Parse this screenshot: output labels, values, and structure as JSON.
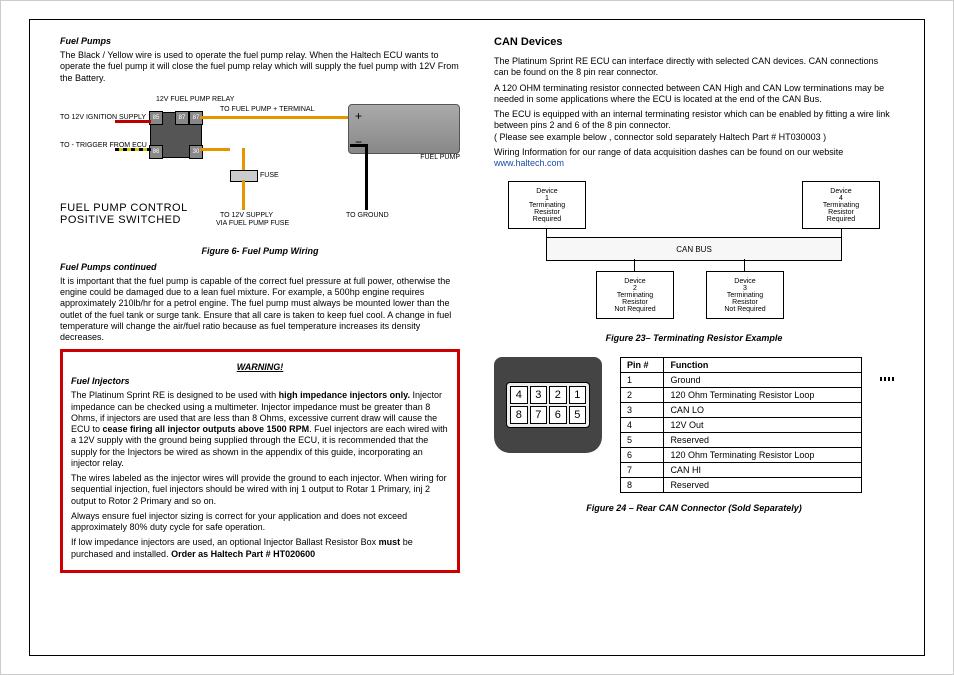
{
  "left": {
    "fuel_pumps_heading": "Fuel Pumps",
    "fuel_pumps_p1": "The Black / Yellow wire is used to operate the fuel pump relay. When the Haltech ECU wants to operate the fuel pump it will close the fuel pump relay which will supply the fuel pump with 12V From the Battery.",
    "diagram_labels": {
      "relay_title": "12V FUEL PUMP RELAY",
      "pin85": "85",
      "pin87": "87",
      "pin87b": "87",
      "pin86": "86",
      "pin30": "30",
      "to_ignition": "TO 12V IGNITION SUPPLY",
      "to_trigger": "TO - TRIGGER FROM ECU",
      "to_terminal": "TO FUEL PUMP + TERMINAL",
      "fuel_pump": "FUEL PUMP",
      "fuse": "FUSE",
      "to_12v_supply": "TO 12V SUPPLY",
      "via_fuse": "VIA FUEL PUMP FUSE",
      "to_ground": "TO GROUND",
      "control_title_1": "FUEL PUMP CONTROL",
      "control_title_2": "POSITIVE SWITCHED"
    },
    "figure6_caption": "Figure 6- Fuel Pump Wiring",
    "fuel_pumps_cont_heading": "Fuel Pumps continued",
    "fuel_pumps_p2": "It is important that the fuel pump is capable of the correct fuel pressure at full power, otherwise the engine could be damaged due to a lean fuel mixture. For example, a 500hp engine requires approximately 210lb/hr for a petrol engine. The fuel pump must always be mounted lower than the outlet of the fuel tank or surge tank. Ensure that all care is taken to keep fuel cool. A change in fuel temperature will change the air/fuel ratio because as fuel temperature increases its density decreases.",
    "warning_title": "WARNING!",
    "injectors_heading": "Fuel Injectors",
    "inj_p1_a": "The Platinum Sprint RE is designed to be used with ",
    "inj_p1_b": "high impedance injectors only.",
    "inj_p1_c": " Injector impedance can be checked using a multimeter. Injector impedance must be greater than 8 Ohms, if injectors are used that are less than 8 Ohms, excessive current draw will cause the ECU to ",
    "inj_p1_d": "cease firing all injector outputs above 1500 RPM",
    "inj_p1_e": ". Fuel injectors are each wired with a 12V supply with the ground being supplied through the ECU, it is recommended that the supply for the Injectors be wired as shown in the appendix of this guide, incorporating an injector relay.",
    "inj_p2": "The wires labeled as the injector wires will provide the ground to each injector. When wiring for sequential injection, fuel injectors should be wired with inj 1 output to Rotar 1 Primary, inj 2 output to Rotor 2 Primary and so on.",
    "inj_p3": "Always ensure fuel injector sizing is correct for your application and does not exceed approximately 80% duty cycle for safe operation.",
    "inj_p4_a": "If low impedance injectors are used, an optional Injector Ballast Resistor Box ",
    "inj_p4_b": "must",
    "inj_p4_c": " be purchased and installed.  ",
    "inj_p4_d": "Order as Haltech Part # HT020600"
  },
  "right": {
    "can_heading": "CAN Devices",
    "can_p1": "The Platinum Sprint RE ECU can interface directly with selected CAN devices. CAN connections can be found on the 8 pin rear connector.",
    "can_p2": "A 120 OHM terminating resistor connected between CAN High and CAN Low terminations may be needed in some applications where the ECU is located at the end of the CAN Bus.",
    "can_p3": "The ECU is equipped with an internal terminating resistor which can be enabled by fitting a wire link between pins 2 and 6 of the 8 pin connector.",
    "can_p3b": "( Please see example below , connector sold separately Haltech Part # HT030003 )",
    "can_p4": "Wiring Information for our range of data acquisition dashes can be found on our website ",
    "website": "www.haltech.com",
    "canbus_label": "CAN BUS",
    "devices": {
      "d1": "Device\n1\nTerminating\nResistor\nRequired",
      "d2": "Device\n2\nTerminating\nResistor\nNot Required",
      "d3": "Device\n3\nTerminating\nResistor\nNot Required",
      "d4": "Device\n4\nTerminating\nResistor\nRequired"
    },
    "figure23_caption": "Figure  23– Terminating Resistor Example",
    "pin_header_num": "Pin #",
    "pin_header_func": "Function",
    "pins": [
      {
        "n": "1",
        "f": "Ground"
      },
      {
        "n": "2",
        "f": "120 Ohm Terminating Resistor Loop"
      },
      {
        "n": "3",
        "f": "CAN LO"
      },
      {
        "n": "4",
        "f": "12V Out"
      },
      {
        "n": "5",
        "f": "Reserved"
      },
      {
        "n": "6",
        "f": "120 Ohm Terminating Resistor Loop"
      },
      {
        "n": "7",
        "f": "CAN HI"
      },
      {
        "n": "8",
        "f": "Reserved"
      }
    ],
    "connector_cells": [
      "4",
      "3",
      "2",
      "1",
      "8",
      "7",
      "6",
      "5"
    ],
    "figure24_caption": "Figure 24 – Rear CAN Connector (Sold Separately)"
  }
}
